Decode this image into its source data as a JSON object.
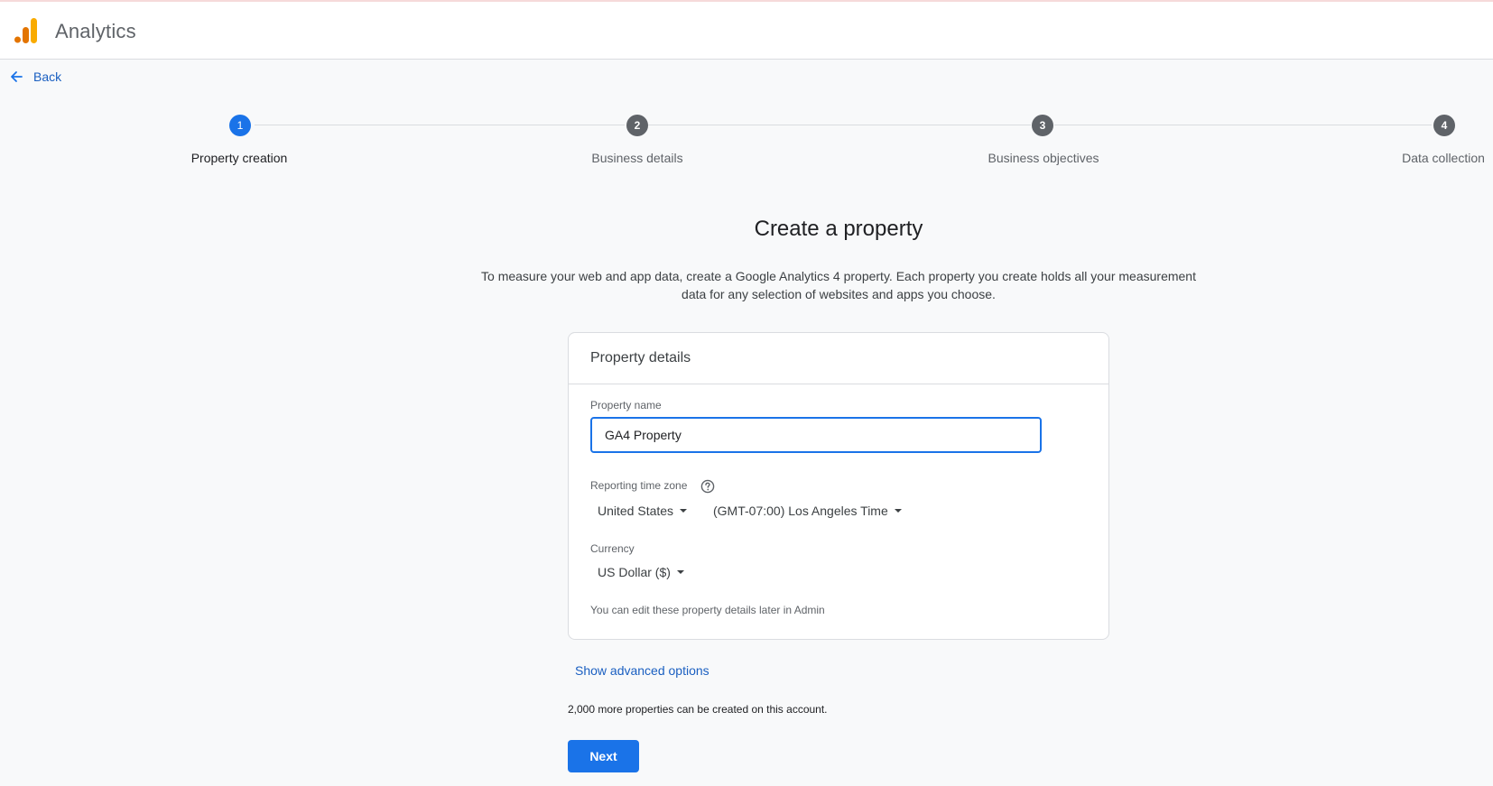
{
  "app": {
    "title": "Analytics"
  },
  "nav": {
    "back_label": "Back"
  },
  "stepper": {
    "steps": [
      {
        "number": "1",
        "label": "Property creation",
        "state": "active"
      },
      {
        "number": "2",
        "label": "Business details",
        "state": "pending"
      },
      {
        "number": "3",
        "label": "Business objectives",
        "state": "pending"
      },
      {
        "number": "4",
        "label": "Data collection",
        "state": "pending"
      }
    ]
  },
  "main": {
    "title": "Create a property",
    "intro": "To measure your web and app data, create a Google Analytics 4 property. Each property you create holds all your measurement data for any selection of websites and apps you choose."
  },
  "card": {
    "header": "Property details",
    "property_name": {
      "label": "Property name",
      "value": "GA4 Property"
    },
    "timezone": {
      "label": "Reporting time zone",
      "country": "United States",
      "zone": "(GMT-07:00) Los Angeles Time"
    },
    "currency": {
      "label": "Currency",
      "value": "US Dollar ($)"
    },
    "hint": "You can edit these property details later in Admin"
  },
  "advanced_link": "Show advanced options",
  "remaining_text": "2,000 more properties can be created on this account.",
  "next_label": "Next",
  "colors": {
    "accent": "#1a73e8",
    "logo_orange": "#f9ab00",
    "logo_dark_orange": "#e37400",
    "step_inactive": "#5f6368"
  },
  "icons": {
    "logo": "analytics-bars-logo",
    "back": "arrow-left-icon",
    "help": "help-circle-icon",
    "caret": "caret-down-icon"
  }
}
